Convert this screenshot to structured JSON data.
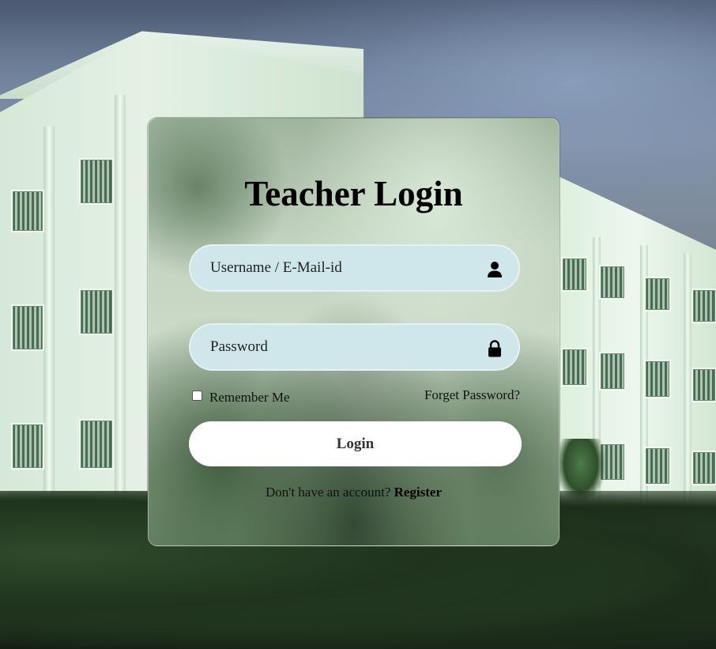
{
  "login": {
    "title": "Teacher Login",
    "username_placeholder": "Username / E-Mail-id",
    "password_placeholder": "Password",
    "remember_label": "Remember Me",
    "forgot_label": "Forget Password?",
    "login_button": "Login",
    "no_account_text": "Don't have an account?",
    "register_link": "Register"
  },
  "icons": {
    "user": "user-icon",
    "lock": "lock-icon"
  },
  "colors": {
    "field_bg": "#cfe6ea",
    "button_bg": "#ffffff",
    "title": "#000000"
  }
}
